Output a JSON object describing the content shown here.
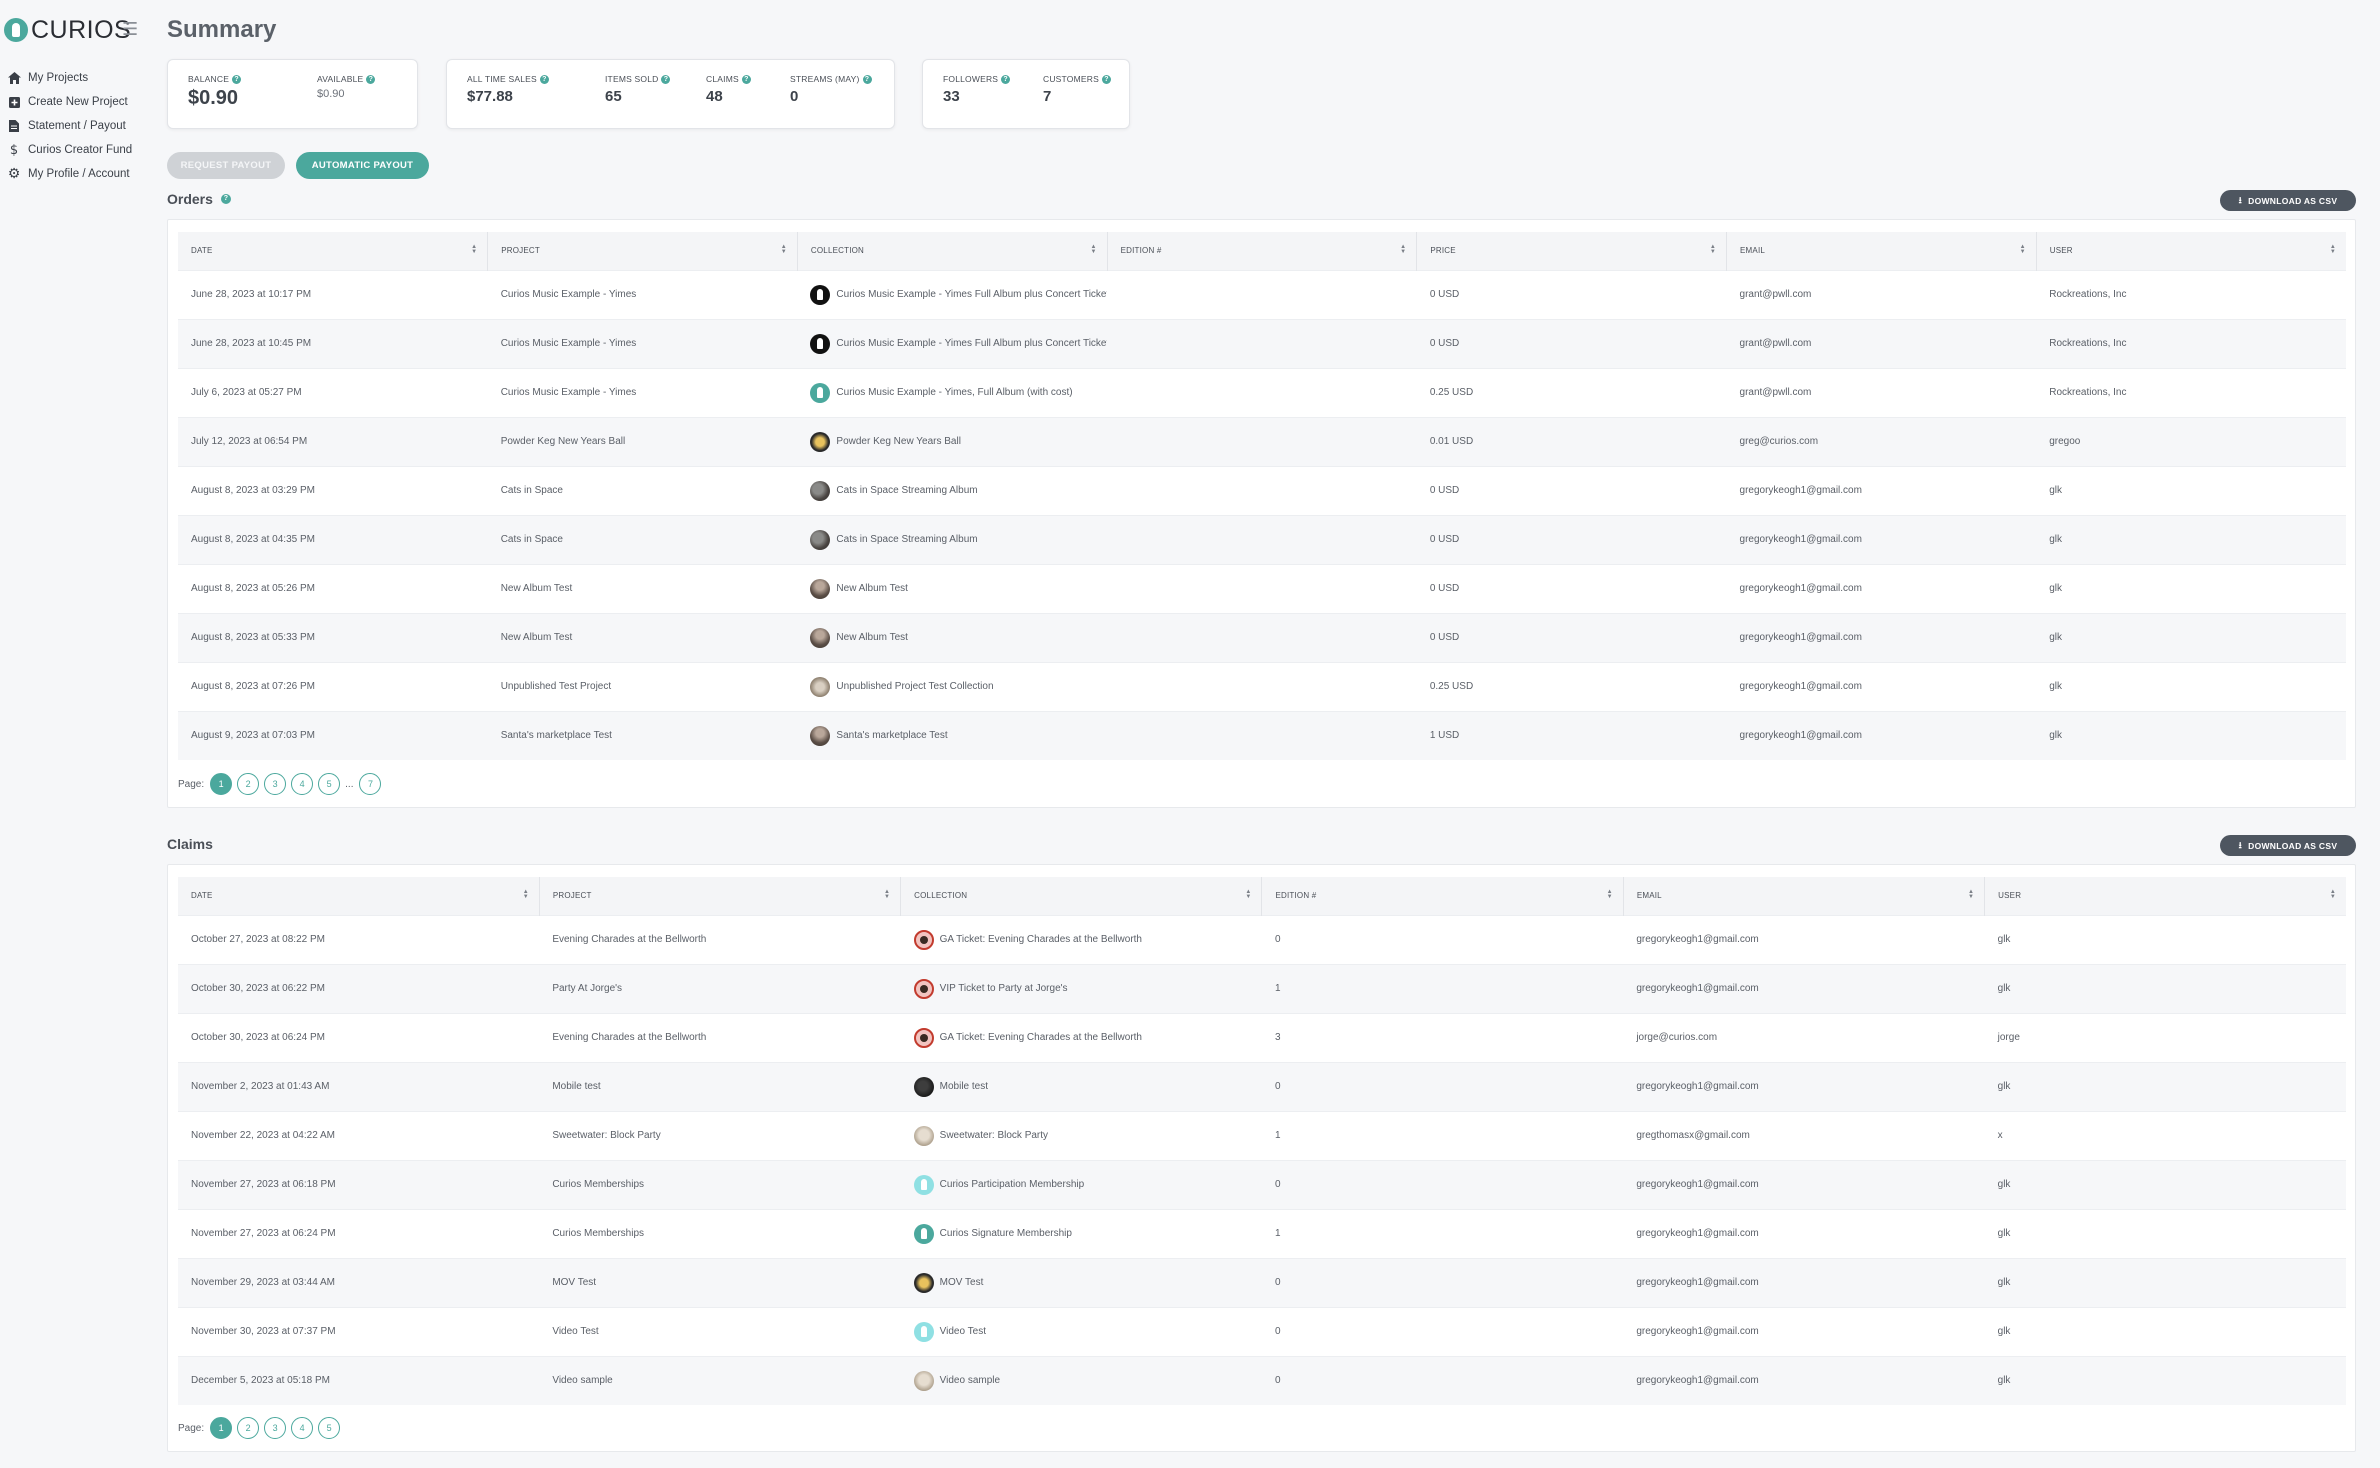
{
  "app": {
    "brand": "CURIOS",
    "accent": "#4ba89d"
  },
  "sidebar": {
    "items": [
      {
        "label": "My Projects",
        "icon": "home-icon"
      },
      {
        "label": "Create New Project",
        "icon": "plus-square-icon"
      },
      {
        "label": "Statement / Payout",
        "icon": "document-icon"
      },
      {
        "label": "Curios Creator Fund",
        "icon": "dollar-icon"
      },
      {
        "label": "My Profile / Account",
        "icon": "gear-icon"
      }
    ]
  },
  "header": {
    "title": "Summary"
  },
  "summary": {
    "balance": {
      "label": "BALANCE",
      "value": "$0.90"
    },
    "available": {
      "label": "AVAILABLE",
      "value": "$0.90"
    },
    "all_time_sales": {
      "label": "ALL TIME SALES",
      "value": "$77.88"
    },
    "items_sold": {
      "label": "ITEMS SOLD",
      "value": "65"
    },
    "claims": {
      "label": "CLAIMS",
      "value": "48"
    },
    "streams": {
      "label": "STREAMS (MAY)",
      "value": "0"
    },
    "followers": {
      "label": "FOLLOWERS",
      "value": "33"
    },
    "customers": {
      "label": "CUSTOMERS",
      "value": "7"
    }
  },
  "payout": {
    "request_label": "REQUEST PAYOUT",
    "automatic_label": "AUTOMATIC PAYOUT"
  },
  "orders": {
    "title": "Orders",
    "csv_label": "DOWNLOAD AS CSV",
    "columns": [
      "DATE",
      "PROJECT",
      "COLLECTION",
      "EDITION #",
      "PRICE",
      "EMAIL",
      "USER"
    ],
    "rows": [
      {
        "date": "June 28, 2023 at 10:17 PM",
        "project": "Curios Music Example - Yimes",
        "collection": "Curios Music Example - Yimes Full Album plus Concert Ticket",
        "thumb": "key",
        "edition": "",
        "price": "0 USD",
        "email": "grant@pwll.com",
        "user": "Rockreations, Inc"
      },
      {
        "date": "June 28, 2023 at 10:45 PM",
        "project": "Curios Music Example - Yimes",
        "collection": "Curios Music Example - Yimes Full Album plus Concert Ticket",
        "thumb": "key",
        "edition": "",
        "price": "0 USD",
        "email": "grant@pwll.com",
        "user": "Rockreations, Inc"
      },
      {
        "date": "July 6, 2023 at 05:27 PM",
        "project": "Curios Music Example - Yimes",
        "collection": "Curios Music Example - Yimes, Full Album (with cost)",
        "thumb": "teal",
        "edition": "",
        "price": "0.25 USD",
        "email": "grant@pwll.com",
        "user": "Rockreations, Inc"
      },
      {
        "date": "July 12, 2023 at 06:54 PM",
        "project": "Powder Keg New Years Ball",
        "collection": "Powder Keg New Years Ball",
        "thumb": "gold",
        "edition": "",
        "price": "0.01 USD",
        "email": "greg@curios.com",
        "user": "gregoo"
      },
      {
        "date": "August 8, 2023 at 03:29 PM",
        "project": "Cats in Space",
        "collection": "Cats in Space Streaming Album",
        "thumb": "photo",
        "edition": "",
        "price": "0 USD",
        "email": "gregorykeogh1@gmail.com",
        "user": "glk"
      },
      {
        "date": "August 8, 2023 at 04:35 PM",
        "project": "Cats in Space",
        "collection": "Cats in Space Streaming Album",
        "thumb": "photo",
        "edition": "",
        "price": "0 USD",
        "email": "gregorykeogh1@gmail.com",
        "user": "glk"
      },
      {
        "date": "August 8, 2023 at 05:26 PM",
        "project": "New Album Test",
        "collection": "New Album Test",
        "thumb": "photo2",
        "edition": "",
        "price": "0 USD",
        "email": "gregorykeogh1@gmail.com",
        "user": "glk"
      },
      {
        "date": "August 8, 2023 at 05:33 PM",
        "project": "New Album Test",
        "collection": "New Album Test",
        "thumb": "photo2",
        "edition": "",
        "price": "0 USD",
        "email": "gregorykeogh1@gmail.com",
        "user": "glk"
      },
      {
        "date": "August 8, 2023 at 07:26 PM",
        "project": "Unpublished Test Project",
        "collection": "Unpublished Project Test Collection",
        "thumb": "photo3",
        "edition": "",
        "price": "0.25 USD",
        "email": "gregorykeogh1@gmail.com",
        "user": "glk"
      },
      {
        "date": "August 9, 2023 at 07:03 PM",
        "project": "Santa's marketplace Test",
        "collection": "Santa's marketplace Test",
        "thumb": "photo2",
        "edition": "",
        "price": "1 USD",
        "email": "gregorykeogh1@gmail.com",
        "user": "glk"
      }
    ],
    "pagination": {
      "label": "Page:",
      "pages": [
        "1",
        "2",
        "3",
        "4",
        "5"
      ],
      "ellipsis": "...",
      "last": "7",
      "current": "1"
    }
  },
  "claims": {
    "title": "Claims",
    "csv_label": "DOWNLOAD AS CSV",
    "columns": [
      "DATE",
      "PROJECT",
      "COLLECTION",
      "EDITION #",
      "EMAIL",
      "USER"
    ],
    "rows": [
      {
        "date": "October 27, 2023 at 08:22 PM",
        "project": "Evening Charades at the Bellworth",
        "collection": "GA Ticket: Evening Charades at the Bellworth",
        "thumb": "ticket",
        "edition": "0",
        "email": "gregorykeogh1@gmail.com",
        "user": "glk"
      },
      {
        "date": "October 30, 2023 at 06:22 PM",
        "project": "Party At Jorge's",
        "collection": "VIP Ticket to Party at Jorge's",
        "thumb": "ticket",
        "edition": "1",
        "email": "gregorykeogh1@gmail.com",
        "user": "glk"
      },
      {
        "date": "October 30, 2023 at 06:24 PM",
        "project": "Evening Charades at the Bellworth",
        "collection": "GA Ticket: Evening Charades at the Bellworth",
        "thumb": "ticket",
        "edition": "3",
        "email": "jorge@curios.com",
        "user": "jorge"
      },
      {
        "date": "November 2, 2023 at 01:43 AM",
        "project": "Mobile test",
        "collection": "Mobile test",
        "thumb": "photo4",
        "edition": "0",
        "email": "gregorykeogh1@gmail.com",
        "user": "glk"
      },
      {
        "date": "November 22, 2023 at 04:22 AM",
        "project": "Sweetwater: Block Party",
        "collection": "Sweetwater: Block Party",
        "thumb": "photo5",
        "edition": "1",
        "email": "gregthomasx@gmail.com",
        "user": "x"
      },
      {
        "date": "November 27, 2023 at 06:18 PM",
        "project": "Curios Memberships",
        "collection": "Curios Participation Membership",
        "thumb": "cyan",
        "edition": "0",
        "email": "gregorykeogh1@gmail.com",
        "user": "glk"
      },
      {
        "date": "November 27, 2023 at 06:24 PM",
        "project": "Curios Memberships",
        "collection": "Curios Signature Membership",
        "thumb": "teal",
        "edition": "1",
        "email": "gregorykeogh1@gmail.com",
        "user": "glk"
      },
      {
        "date": "November 29, 2023 at 03:44 AM",
        "project": "MOV Test",
        "collection": "MOV Test",
        "thumb": "gold",
        "edition": "0",
        "email": "gregorykeogh1@gmail.com",
        "user": "glk"
      },
      {
        "date": "November 30, 2023 at 07:37 PM",
        "project": "Video Test",
        "collection": "Video Test",
        "thumb": "cyan",
        "edition": "0",
        "email": "gregorykeogh1@gmail.com",
        "user": "glk"
      },
      {
        "date": "December 5, 2023 at 05:18 PM",
        "project": "Video sample",
        "collection": "Video sample",
        "thumb": "photo5",
        "edition": "0",
        "email": "gregorykeogh1@gmail.com",
        "user": "glk"
      }
    ],
    "pagination": {
      "label": "Page:",
      "pages": [
        "1",
        "2",
        "3",
        "4",
        "5"
      ],
      "current": "1"
    }
  }
}
